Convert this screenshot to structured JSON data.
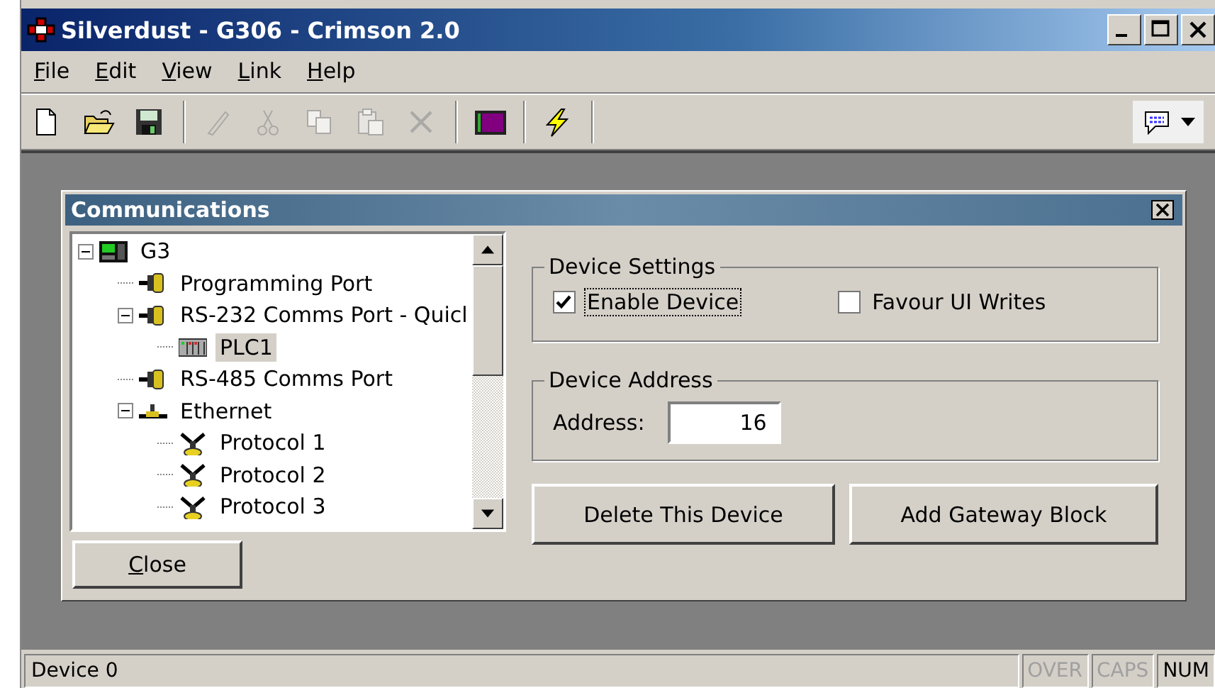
{
  "window": {
    "title": "Silverdust - G306 - Crimson 2.0"
  },
  "menu": [
    "File",
    "Edit",
    "View",
    "Link",
    "Help"
  ],
  "toolbar": [
    {
      "kind": "new",
      "disabled": false
    },
    {
      "kind": "open",
      "disabled": false
    },
    {
      "kind": "save",
      "disabled": false
    },
    {
      "kind": "sep"
    },
    {
      "kind": "pen",
      "disabled": true
    },
    {
      "kind": "cut",
      "disabled": true
    },
    {
      "kind": "copy",
      "disabled": true
    },
    {
      "kind": "paste",
      "disabled": true
    },
    {
      "kind": "delete",
      "disabled": true
    },
    {
      "kind": "sep"
    },
    {
      "kind": "screen",
      "disabled": false
    },
    {
      "kind": "sep"
    },
    {
      "kind": "bolt",
      "disabled": false
    },
    {
      "kind": "sep"
    }
  ],
  "dialog": {
    "title": "Communications",
    "tree": [
      {
        "label": "G3",
        "kind": "panel",
        "expanded": true,
        "selected": false,
        "children": [
          {
            "label": "Programming Port",
            "kind": "port",
            "selected": false
          },
          {
            "label": "RS-232 Comms Port - Quicl",
            "kind": "port",
            "expanded": true,
            "selected": false,
            "children": [
              {
                "label": "PLC1",
                "kind": "plc",
                "selected": true
              }
            ]
          },
          {
            "label": "RS-485 Comms Port",
            "kind": "port",
            "selected": false
          },
          {
            "label": "Ethernet",
            "kind": "network",
            "expanded": true,
            "selected": false,
            "children": [
              {
                "label": "Protocol 1",
                "kind": "protocol",
                "selected": false
              },
              {
                "label": "Protocol 2",
                "kind": "protocol",
                "selected": false
              },
              {
                "label": "Protocol 3",
                "kind": "protocol",
                "selected": false
              }
            ]
          }
        ]
      }
    ],
    "close_button": "Close",
    "device_settings": {
      "title": "Device Settings",
      "options": [
        {
          "label": "Enable Device",
          "checked": true,
          "focused": true
        },
        {
          "label": "Favour UI Writes",
          "checked": false,
          "focused": false
        }
      ]
    },
    "device_address": {
      "title": "Device Address",
      "label": "Address:",
      "value": "16"
    },
    "buttons": [
      "Delete This Device",
      "Add Gateway Block"
    ]
  },
  "status_bar": {
    "text": "Device 0",
    "indicators": [
      {
        "label": "OVER",
        "on": false
      },
      {
        "label": "CAPS",
        "on": false
      },
      {
        "label": "NUM",
        "on": true
      }
    ]
  }
}
